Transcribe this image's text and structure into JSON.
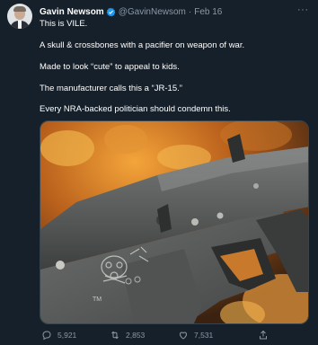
{
  "tweet": {
    "author_name": "Gavin Newsom",
    "handle": "@GavinNewsom",
    "separator": "·",
    "date": "Feb 16",
    "more_label": "···",
    "lines": [
      "This is VILE.",
      "A skull & crossbones with a pacifier on weapon of war.",
      "Made to look “cute” to appeal to kids.",
      "The manufacturer calls this a “JR-15.”",
      "Every NRA-backed politician should condemn this."
    ]
  },
  "media": {
    "engraving_text": "TM"
  },
  "actions": {
    "replies": "5,921",
    "retweets": "2,853",
    "likes": "7,531"
  },
  "colors": {
    "background": "#15202b",
    "secondary_text": "#8b98a5",
    "verified": "#1d9bf0"
  },
  "icons": [
    "verified-badge-icon",
    "reply-icon",
    "retweet-icon",
    "like-icon",
    "share-icon"
  ]
}
